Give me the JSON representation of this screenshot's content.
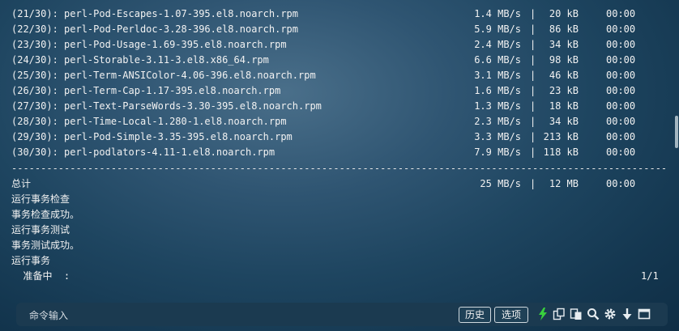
{
  "downloads": [
    {
      "name": "(21/30): perl-Pod-Escapes-1.07-395.el8.noarch.rpm",
      "speed": "1.4 MB/s",
      "size": " 20 kB",
      "time": "00:00"
    },
    {
      "name": "(22/30): perl-Pod-Perldoc-3.28-396.el8.noarch.rpm",
      "speed": "5.9 MB/s",
      "size": " 86 kB",
      "time": "00:00"
    },
    {
      "name": "(23/30): perl-Pod-Usage-1.69-395.el8.noarch.rpm",
      "speed": "2.4 MB/s",
      "size": " 34 kB",
      "time": "00:00"
    },
    {
      "name": "(24/30): perl-Storable-3.11-3.el8.x86_64.rpm",
      "speed": "6.6 MB/s",
      "size": " 98 kB",
      "time": "00:00"
    },
    {
      "name": "(25/30): perl-Term-ANSIColor-4.06-396.el8.noarch.rpm",
      "speed": "3.1 MB/s",
      "size": " 46 kB",
      "time": "00:00"
    },
    {
      "name": "(26/30): perl-Term-Cap-1.17-395.el8.noarch.rpm",
      "speed": "1.6 MB/s",
      "size": " 23 kB",
      "time": "00:00"
    },
    {
      "name": "(27/30): perl-Text-ParseWords-3.30-395.el8.noarch.rpm",
      "speed": "1.3 MB/s",
      "size": " 18 kB",
      "time": "00:00"
    },
    {
      "name": "(28/30): perl-Time-Local-1.280-1.el8.noarch.rpm",
      "speed": "2.3 MB/s",
      "size": " 34 kB",
      "time": "00:00"
    },
    {
      "name": "(29/30): perl-Pod-Simple-3.35-395.el8.noarch.rpm",
      "speed": "3.3 MB/s",
      "size": "213 kB",
      "time": "00:00"
    },
    {
      "name": "(30/30): perl-podlators-4.11-1.el8.noarch.rpm",
      "speed": "7.9 MB/s",
      "size": "118 kB",
      "time": "00:00"
    }
  ],
  "separator": "-------------------------------------------------------------------------------------------------------------------------------------",
  "total": {
    "label": "总计",
    "speed": "25 MB/s",
    "size": " 12 MB",
    "time": "00:00"
  },
  "messages": [
    "运行事务检查",
    "事务检查成功。",
    "运行事务测试",
    "事务测试成功。",
    "运行事务"
  ],
  "preparing": {
    "label": "  准备中  :",
    "progress": "1/1"
  },
  "cmdbar": {
    "input_label": "命令输入",
    "history_label": "历史",
    "options_label": "选项"
  },
  "colors": {
    "bolt": "#38d13d",
    "icon": "#e6ecf0"
  }
}
